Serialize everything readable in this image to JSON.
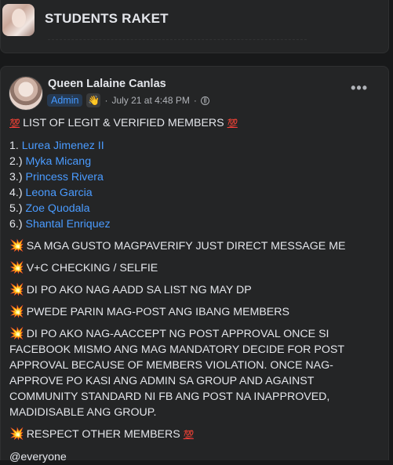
{
  "group": {
    "title": "STUDENTS RAKET"
  },
  "post": {
    "author": "Queen Lalaine Canlas",
    "role_badge": "Admin",
    "badge_icon": "wave-hand-icon",
    "date": "July 21 at 4:48 PM",
    "separator": "·",
    "privacy_icon": "globe-icon",
    "more_label": "•••",
    "headline": "LIST OF LEGIT & VERIFIED MEMBERS",
    "emoji_100": "💯",
    "emoji_burst": "💥",
    "members": [
      {
        "prefix": "1.",
        "name": "Lurea Jimenez II"
      },
      {
        "prefix": "2.)",
        "name": "Myka Micang"
      },
      {
        "prefix": "3.)",
        "name": "Princess Rivera"
      },
      {
        "prefix": "4.)",
        "name": "Leona Garcia"
      },
      {
        "prefix": "5.)",
        "name": "Zoe Quodala"
      },
      {
        "prefix": "6.)",
        "name": "Shantal Enriquez"
      }
    ],
    "notes": [
      "SA MGA GUSTO MAGPAVERIFY JUST DIRECT MESSAGE ME",
      "V+C CHECKING / SELFIE",
      "DI PO AKO NAG AADD SA LIST NG MAY DP",
      "PWEDE PARIN MAG-POST ANG IBANG MEMBERS",
      "DI PO AKO NAG-AACCEPT NG POST APPROVAL ONCE SI FACEBOOK MISMO ANG MAG MANDATORY DECIDE FOR POST APPROVAL BECAUSE OF MEMBERS VIOLATION. ONCE NAG-APPROVE PO KASI ANG ADMIN SA GROUP AND AGAINST COMMUNITY STANDARD NI FB ANG POST NA INAPPROVED, MADIDISABLE ANG GROUP.",
      "RESPECT OTHER MEMBERS"
    ],
    "mention": "@everyone"
  },
  "colors": {
    "background": "#18191a",
    "card": "#242526",
    "link": "#4a9bff",
    "admin_badge_bg": "#263951",
    "admin_badge_text": "#4599ff"
  }
}
